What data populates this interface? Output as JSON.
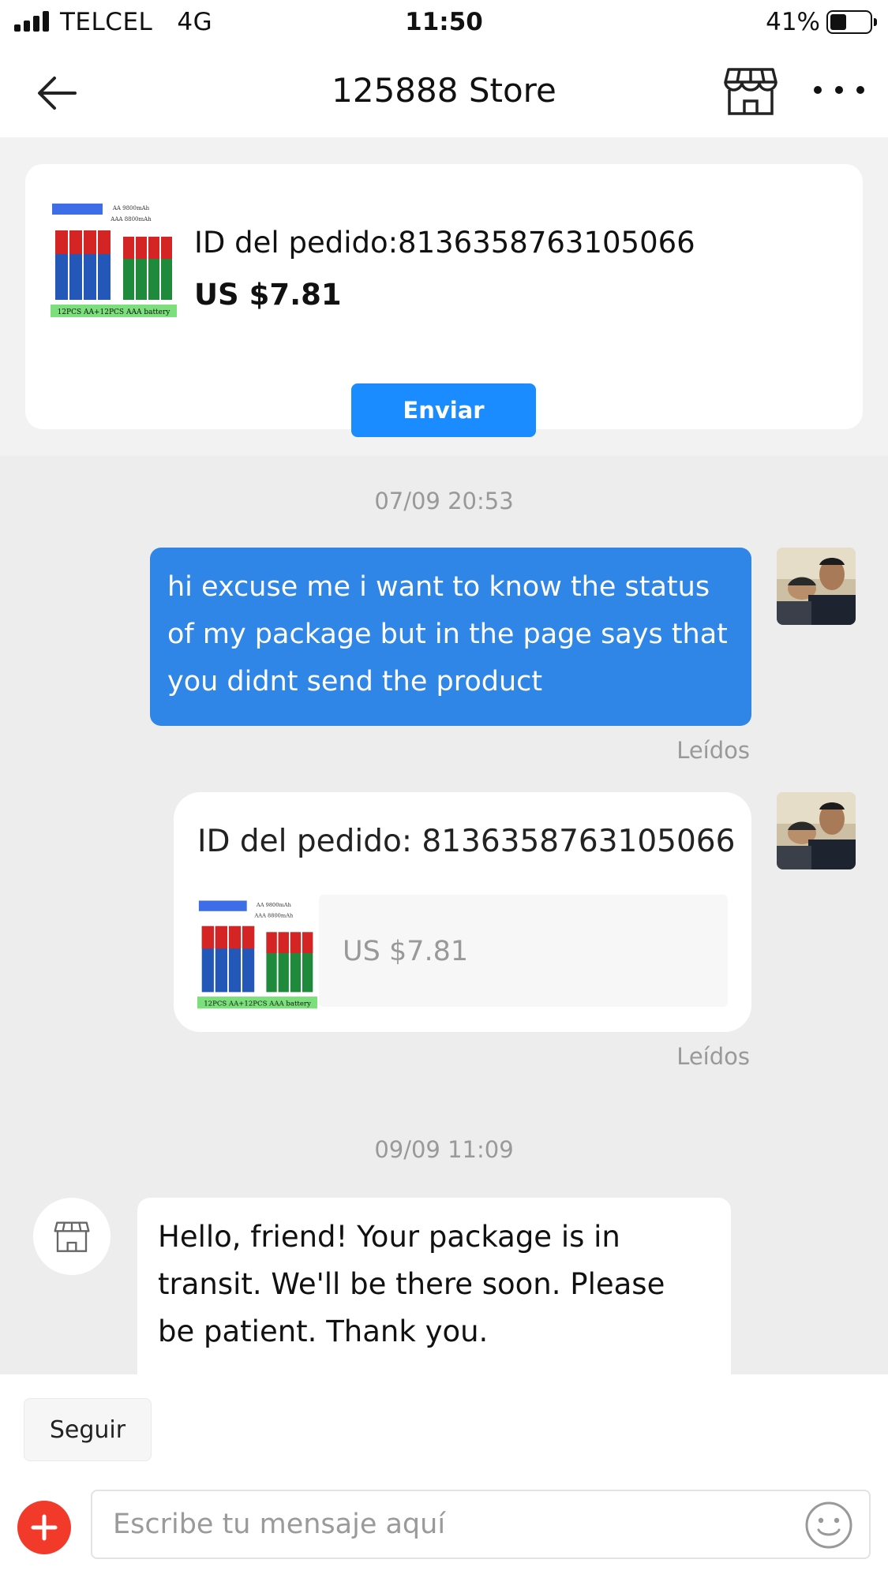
{
  "status_bar": {
    "carrier": "TELCEL   4G",
    "time": "11:50",
    "battery_percent": "41%",
    "battery_level": 0.41,
    "icons": [
      "signal-icon",
      "battery-icon"
    ]
  },
  "header": {
    "title": "125888 Store",
    "icons": [
      "back-arrow-icon",
      "store-icon",
      "more-icon"
    ]
  },
  "order_card": {
    "order_id": "ID del pedido:8136358763105066",
    "price": "US $7.81",
    "send_label": "Enviar",
    "thumbnail": {
      "top_text_1": "AA 9800mAh",
      "top_text_2": "AAA 8800mAh",
      "bottom_text": "12PCS AA+12PCS AAA battery"
    }
  },
  "chat": {
    "timestamp_1": "07/09 20:53",
    "message_1": "hi excuse me i want to know the status of my package but in the page says that you didnt send the product",
    "read_1": "Leídos",
    "order_message": {
      "order_id": "ID del pedido: 8136358763105066",
      "price": "US $7.81"
    },
    "read_2": "Leídos",
    "timestamp_2": "09/09 11:09",
    "message_2": "Hello, friend! Your package is in transit. We'll be there soon. Please be patient. Thank you."
  },
  "bottom_bar": {
    "follow_label": "Seguir",
    "input_placeholder": "Escribe tu mensaje aquí",
    "icons": [
      "plus-icon",
      "emoji-icon"
    ]
  },
  "colors": {
    "accent_blue": "#1a8cff",
    "bubble_blue": "#2f86e6",
    "plus_red": "#f23a2a",
    "chat_bg": "#ededed"
  }
}
